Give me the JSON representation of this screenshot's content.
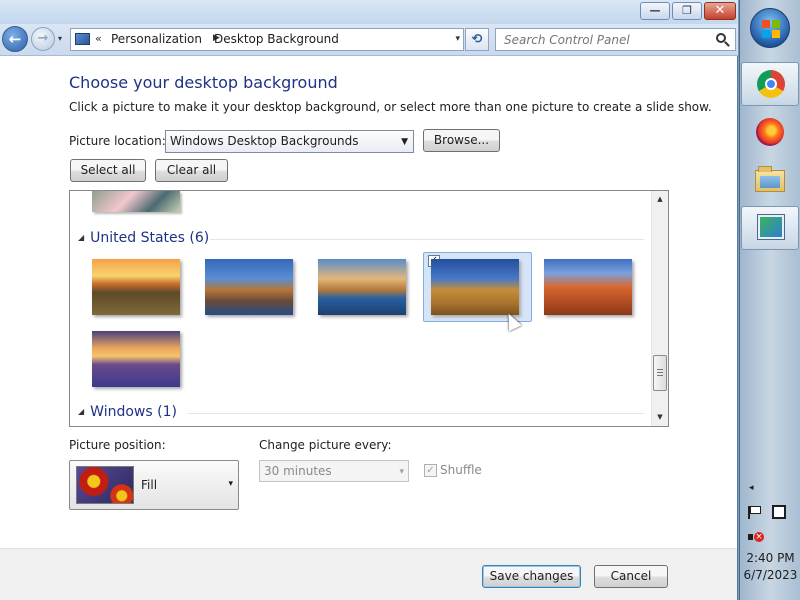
{
  "window": {
    "minimize_glyph": "—",
    "maximize_glyph": "❐",
    "close_glyph": "✕"
  },
  "navigation": {
    "back_glyph": "←",
    "forward_glyph": "→",
    "recent_glyph": "▾",
    "address": {
      "overflow_glyph": "«",
      "separator_glyph": "▶",
      "breadcrumbs": [
        "Personalization",
        "Desktop Background"
      ],
      "dropdown_glyph": "▾"
    },
    "refresh_glyph": "⟲",
    "search_placeholder": "Search Control Panel"
  },
  "page": {
    "title": "Choose your desktop background",
    "subtitle": "Click a picture to make it your desktop background, or select more than one picture to create a slide show.",
    "location_label": "Picture location:",
    "location_value": "Windows Desktop Backgrounds",
    "browse_label": "Browse...",
    "select_all_label": "Select all",
    "clear_all_label": "Clear all"
  },
  "picture_groups": [
    {
      "name": "United States (6)",
      "thumbnails": [
        {
          "subject": "sunset-over-ranch",
          "selected": false
        },
        {
          "subject": "lighthouse-on-coast",
          "selected": false
        },
        {
          "subject": "rock-in-water",
          "selected": false
        },
        {
          "subject": "hay-bale-field",
          "selected": true
        },
        {
          "subject": "red-rock-arch",
          "selected": false
        },
        {
          "subject": "lake-with-flowers",
          "selected": false
        }
      ]
    },
    {
      "name": "Windows (1)"
    }
  ],
  "picture_position": {
    "label": "Picture position:",
    "value": "Fill",
    "dropdown_glyph": "▾"
  },
  "slideshow": {
    "interval_label": "Change picture every:",
    "interval_value": "30 minutes",
    "dropdown_glyph": "▾",
    "shuffle_label": "Shuffle",
    "shuffle_checked": true,
    "check_glyph": "✓"
  },
  "footer": {
    "save_label": "Save changes",
    "cancel_label": "Cancel"
  },
  "taskbar": {
    "pinned": [
      "chrome-icon",
      "firefox-icon",
      "explorer-icon",
      "control-panel-icon"
    ],
    "tray_arrow_glyph": "◂",
    "clock_time": "2:40 PM",
    "clock_date": "6/7/2023"
  },
  "colors": {
    "title_blue": "#1e3287",
    "selection_fill": "#d5e5f7",
    "selection_border": "#84acdd",
    "taskbar": "#b9cbdc"
  }
}
